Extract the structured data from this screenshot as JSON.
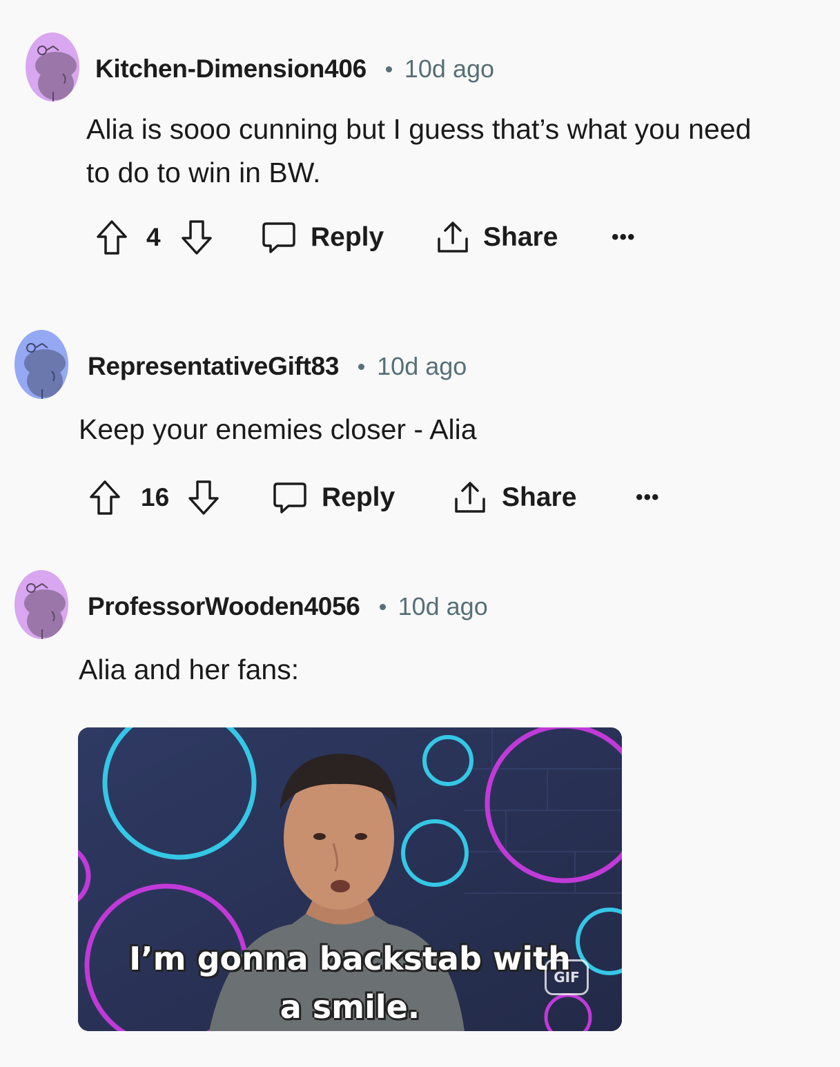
{
  "colors": {
    "background": "#f9f9fa",
    "text": "#1a1a1b",
    "meta": "#576f76",
    "avatar_purple": "#d9a6f0",
    "avatar_blue": "#95a8f3"
  },
  "comments": [
    {
      "username": "Kitchen-Dimension406",
      "time": "10d ago",
      "body_lines": [
        "Alia is sooo cunning but I guess that’s what you need",
        "to do to win in BW."
      ],
      "score": "4",
      "reply_label": "Reply",
      "share_label": "Share",
      "more_label": "•••",
      "avatar_icon": "snoo-avatar-icon"
    },
    {
      "username": "RepresentativeGift83",
      "time": "10d ago",
      "body_lines": [
        "Keep your enemies closer - Alia"
      ],
      "score": "16",
      "reply_label": "Reply",
      "share_label": "Share",
      "more_label": "•••",
      "avatar_icon": "snoo-avatar-icon"
    },
    {
      "username": "ProfessorWooden4056",
      "time": "10d ago",
      "body_lines": [
        "Alia and her fans:"
      ],
      "gif": {
        "caption_lines": [
          "I’m gonna backstab with",
          "a smile."
        ],
        "badge": "GIF"
      },
      "avatar_icon": "snoo-avatar-icon"
    }
  ],
  "icons": {
    "upvote": "upvote-arrow-icon",
    "downvote": "downvote-arrow-icon",
    "reply": "speech-bubble-icon",
    "share": "share-upload-icon",
    "more": "more-options-icon"
  }
}
